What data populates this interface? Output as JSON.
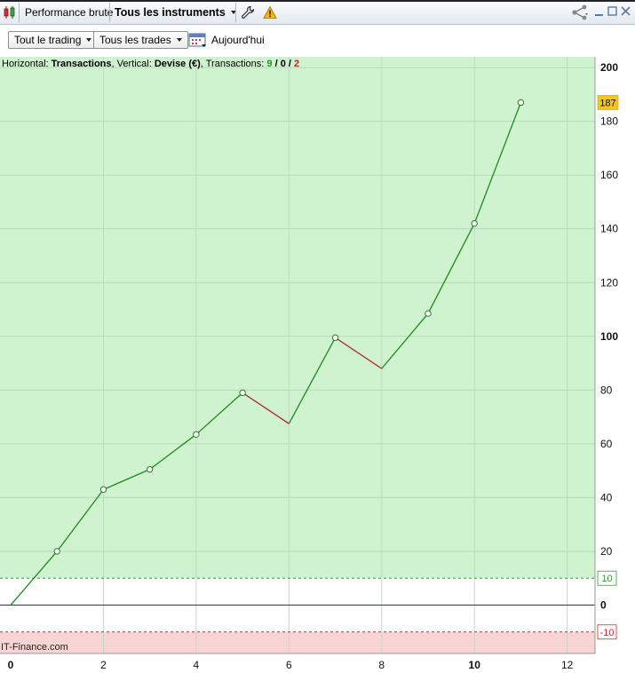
{
  "toolbar": {
    "title": "Performance brute",
    "instruments": "Tous les instruments",
    "icons": [
      "candlestick-icon",
      "wrench-icon",
      "warning-icon",
      "share-icon",
      "minimize-icon",
      "maximize-icon",
      "close-icon"
    ]
  },
  "filters": {
    "trading": "Tout le trading",
    "trades": "Tous les trades",
    "period": "Aujourd'hui"
  },
  "header": {
    "horizontal_label": "Horizontal:",
    "horizontal_value": "Transactions",
    "vertical_label": "Vertical:",
    "vertical_value": "Devise (€)",
    "transactions_label": "Transactions:",
    "won": "9",
    "neutral": "0",
    "lost": "2",
    "sep": "/"
  },
  "watermark": "IT-Finance.com",
  "colors": {
    "profit_zone": "#cff2cf",
    "loss_zone": "#f8d4d4",
    "neutral_zone": "#ffffff",
    "up_line": "#1c8c1c",
    "down_line": "#b22222",
    "last_value_badge": "#f5c518",
    "threshold_pos": "#3a9a3a",
    "threshold_neg": "#c03030"
  },
  "chart_data": {
    "type": "line",
    "x": [
      0,
      1,
      2,
      3,
      4,
      5,
      6,
      7,
      8,
      9,
      10,
      11
    ],
    "values": [
      0,
      20,
      43,
      50.5,
      63.5,
      79,
      67.5,
      99.5,
      88,
      108.5,
      142,
      187
    ],
    "markers_at": [
      1,
      2,
      3,
      4,
      5,
      7,
      9,
      10,
      11
    ],
    "last_value_label": "187",
    "xlim": [
      0,
      12.6
    ],
    "ylim": [
      -18,
      204
    ],
    "x_ticks": [
      0,
      2,
      4,
      6,
      8,
      10,
      12
    ],
    "x_tick_labels": [
      "0",
      "2",
      "4",
      "6",
      "8",
      "10",
      "12"
    ],
    "x_bold_ticks": [
      "0",
      "10"
    ],
    "y_ticks": [
      20,
      40,
      60,
      80,
      100,
      120,
      140,
      160,
      180,
      200
    ],
    "y_tick_labels": [
      "20",
      "40",
      "60",
      "80",
      "100",
      "120",
      "140",
      "160",
      "180",
      "200"
    ],
    "y_bold_ticks": [
      "0",
      "100",
      "200"
    ],
    "zero_label": "0",
    "thresholds": [
      {
        "value": 10,
        "label": "10"
      },
      {
        "value": -10,
        "label": "-10"
      }
    ],
    "grid": true,
    "xlabel": "Transactions",
    "ylabel": "Devise (€)"
  }
}
